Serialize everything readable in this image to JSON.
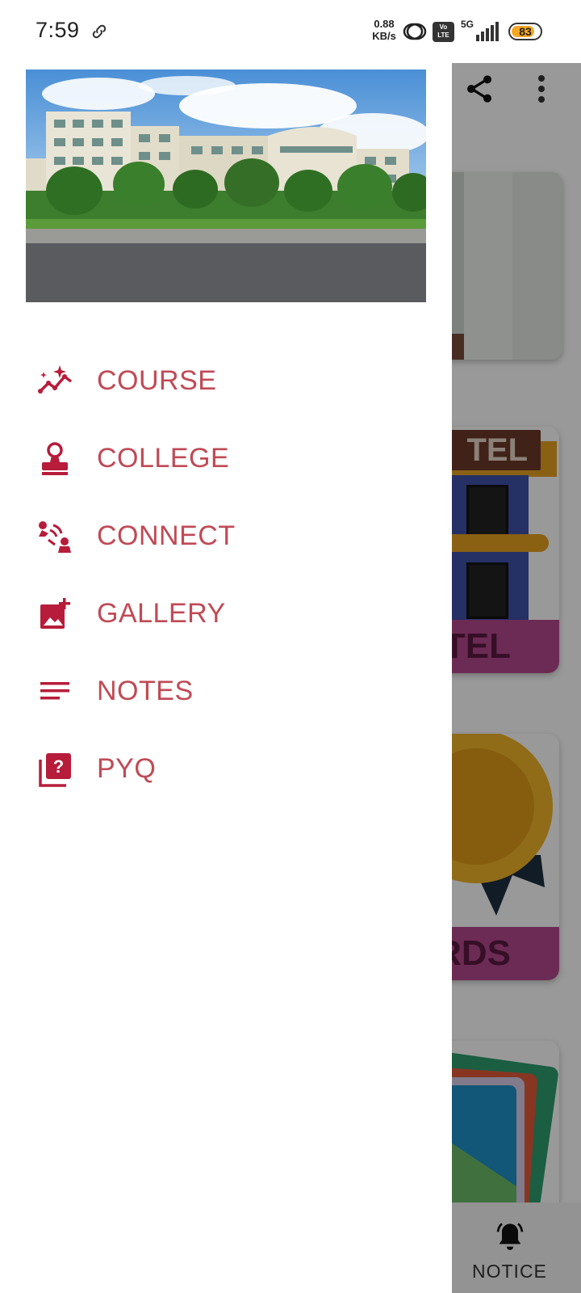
{
  "status_bar": {
    "time": "7:59",
    "net_speed_value": "0.88",
    "net_speed_unit": "KB/s",
    "volte_top": "Vo",
    "volte_bottom": "LTE",
    "network_type": "5G",
    "battery_level": "83",
    "battery_fraction": 0.83
  },
  "drawer": {
    "header_image": "college-building-photo",
    "accent_color": "#c04a55",
    "icon_color": "#b71c3a",
    "items": [
      {
        "label": "COURSE",
        "icon": "trending-sparkle-icon"
      },
      {
        "label": "COLLEGE",
        "icon": "stamp-icon"
      },
      {
        "label": "CONNECT",
        "icon": "people-connect-icon"
      },
      {
        "label": "GALLERY",
        "icon": "add-photo-icon"
      },
      {
        "label": "NOTES",
        "icon": "notes-lines-icon"
      },
      {
        "label": "PYQ",
        "icon": "question-library-icon"
      }
    ]
  },
  "background": {
    "card2_label": "TEL",
    "card2_band": "TEL",
    "card3_band": "RDS",
    "bottom_nav_label": "NOTICE"
  }
}
